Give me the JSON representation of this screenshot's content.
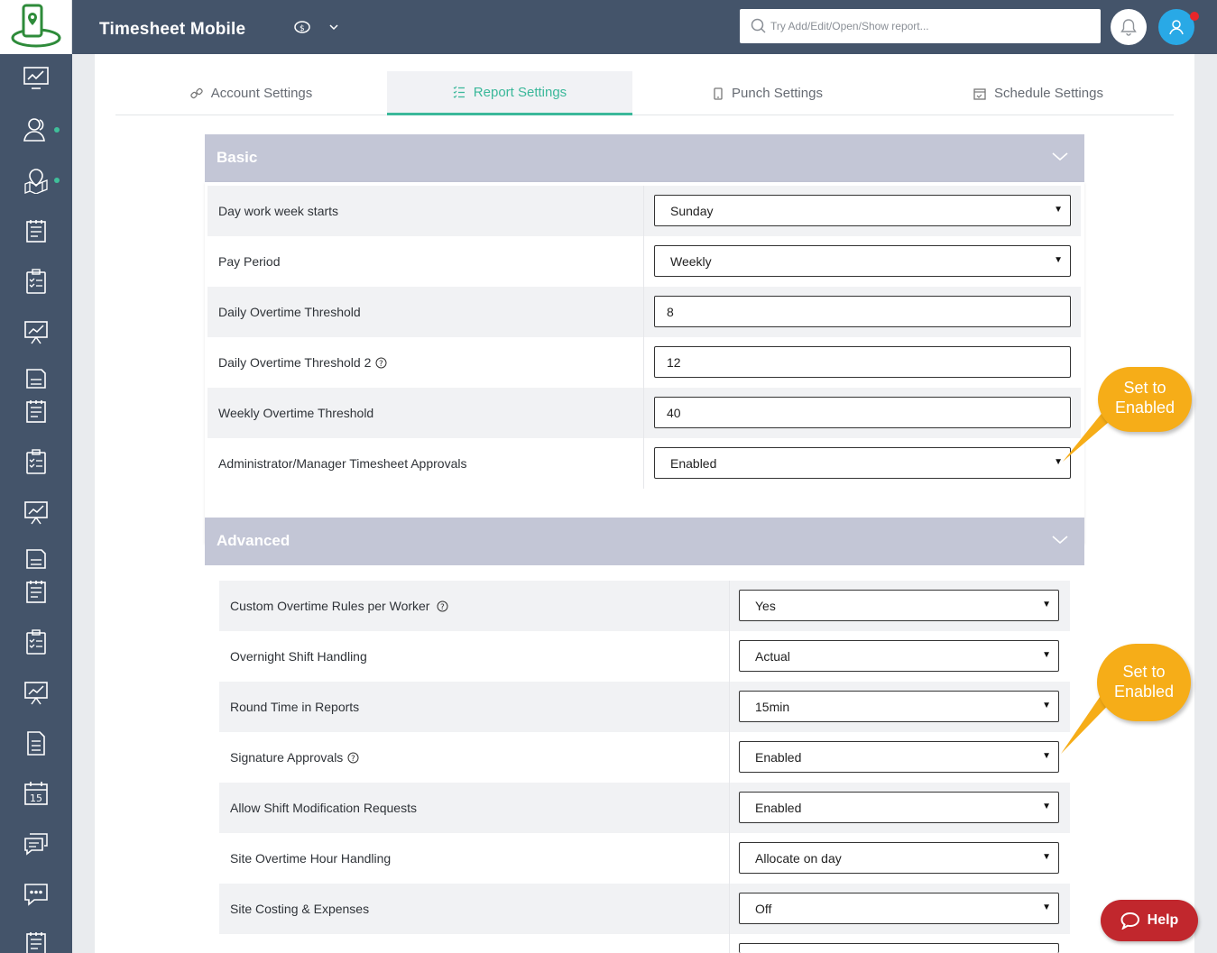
{
  "app": {
    "title": "Timesheet Mobile"
  },
  "search": {
    "placeholder": "Try Add/Edit/Open/Show report..."
  },
  "tabs": [
    {
      "label": "Account Settings",
      "icon": "link-icon"
    },
    {
      "label": "Report Settings",
      "icon": "list-icon",
      "active": true
    },
    {
      "label": "Punch Settings",
      "icon": "phone-icon"
    },
    {
      "label": "Schedule Settings",
      "icon": "calendar-icon"
    }
  ],
  "basic": {
    "title": "Basic",
    "rows": [
      {
        "label": "Day work week starts",
        "value": "Sunday",
        "type": "select"
      },
      {
        "label": "Pay Period",
        "value": "Weekly",
        "type": "select"
      },
      {
        "label": "Daily Overtime Threshold",
        "value": "8",
        "type": "input"
      },
      {
        "label": "Daily Overtime Threshold 2",
        "value": "12",
        "type": "input",
        "help": true
      },
      {
        "label": "Weekly Overtime Threshold",
        "value": "40",
        "type": "input"
      },
      {
        "label": "Administrator/Manager Timesheet Approvals",
        "value": "Enabled",
        "type": "select"
      }
    ]
  },
  "advanced": {
    "title": "Advanced",
    "rows": [
      {
        "label": "Custom Overtime Rules per Worker",
        "value": "Yes",
        "type": "select",
        "help": true
      },
      {
        "label": "Overnight Shift Handling",
        "value": "Actual",
        "type": "select"
      },
      {
        "label": "Round Time in Reports",
        "value": "15min",
        "type": "select"
      },
      {
        "label": "Signature Approvals",
        "value": "Enabled",
        "type": "select",
        "help": true
      },
      {
        "label": "Allow Shift Modification Requests",
        "value": "Enabled",
        "type": "select"
      },
      {
        "label": "Site Overtime Hour Handling",
        "value": "Allocate on day",
        "type": "select"
      },
      {
        "label": "Site Costing & Expenses",
        "value": "Off",
        "type": "select"
      }
    ]
  },
  "callouts": [
    {
      "line1": "Set to",
      "line2": "Enabled"
    },
    {
      "line1": "Set to",
      "line2": "Enabled"
    }
  ],
  "help_button": {
    "label": "Help"
  },
  "colors": {
    "topbar": "#44546a",
    "accent": "#3bb89a",
    "section_header": "#c3c6d6",
    "callout": "#f6ad18",
    "help": "#c1272d",
    "user": "#29a9e6"
  }
}
